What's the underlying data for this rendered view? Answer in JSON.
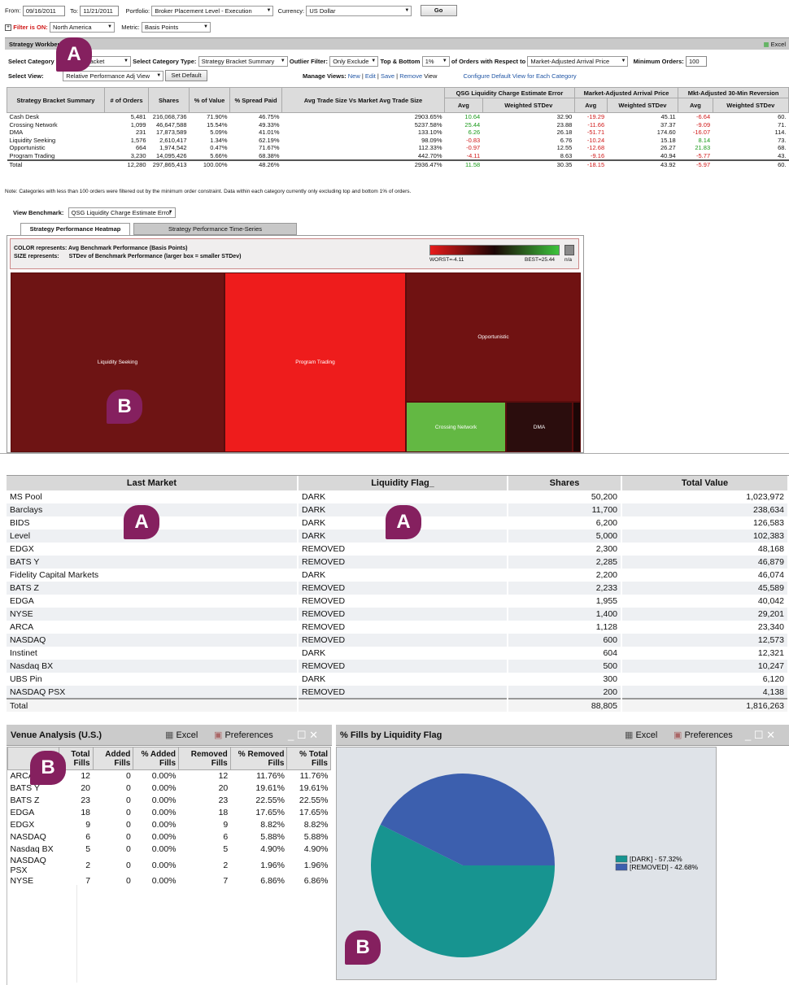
{
  "filters": {
    "from_label": "From:",
    "from_value": "09/16/2011",
    "to_label": "To:",
    "to_value": "11/21/2011",
    "portfolio_label": "Portfolio:",
    "portfolio_value": "Broker Placement Level - Execution",
    "currency_label": "Currency:",
    "currency_value": "US Dollar",
    "go_label": "Go",
    "filter_toggle": "+",
    "filter_label": "Filter is ON:",
    "filter_value": "North America",
    "metric_label": "Metric:",
    "metric_value": "Basis Points"
  },
  "workbench": {
    "title": "Strategy Workbench",
    "excel_label": "Excel",
    "select_category_label": "Select Category",
    "select_category_value": "Strategy Bracket",
    "select_type_label": "Select Category Type:",
    "select_type_value": "Strategy Bracket Summary",
    "outlier_label": "Outlier Filter:",
    "outlier_value": "Only Exclude",
    "topbottom_label": "Top & Bottom",
    "topbottom_value": "1%",
    "respect_label": "of Orders with Respect to",
    "respect_value": "Market-Adjusted Arrival Price",
    "min_orders_label": "Minimum Orders:",
    "min_orders_value": "100",
    "select_view_label": "Select View:",
    "select_view_value": "Relative Performance Adj View",
    "set_default_label": "Set Default",
    "manage_views_label": "Manage Views:",
    "view_new": "New",
    "view_edit": "Edit",
    "view_save": "Save",
    "view_remove": "Remove",
    "view_word": "View",
    "configure_label": "Configure Default View for Each Category",
    "sep": "|"
  },
  "summary": {
    "headers": {
      "category": "Strategy Bracket Summary",
      "orders": "# of Orders",
      "shares": "Shares",
      "pct_value": "% of Value",
      "spread": "% Spread Paid",
      "avg_trade": "Avg Trade Size Vs Market Avg Trade Size",
      "grp1": "QSG Liquidity Charge Estimate Error",
      "grp2": "Market-Adjusted Arrival Price",
      "grp3": "Mkt-Adjusted 30-Min Reversion",
      "avg": "Avg",
      "wstd": "Weighted STDev"
    },
    "rows": [
      {
        "name": "Cash Desk",
        "orders": "5,481",
        "shares": "216,068,736",
        "pct": "71.90%",
        "spread": "46.75%",
        "avgtrade": "2903.65%",
        "a1": "10.64",
        "a1c": "g",
        "w1": "32.90",
        "a2": "-19.29",
        "a2c": "rd",
        "w2": "45.11",
        "a3": "-6.64",
        "a3c": "rd",
        "w3": "60."
      },
      {
        "name": "Crossing Network",
        "orders": "1,099",
        "shares": "46,647,588",
        "pct": "15.54%",
        "spread": "49.33%",
        "avgtrade": "5237.58%",
        "a1": "25.44",
        "a1c": "g",
        "w1": "23.88",
        "a2": "-11.66",
        "a2c": "rd",
        "w2": "37.37",
        "a3": "-9.09",
        "a3c": "rd",
        "w3": "71."
      },
      {
        "name": "DMA",
        "orders": "231",
        "shares": "17,873,589",
        "pct": "5.09%",
        "spread": "41.01%",
        "avgtrade": "133.10%",
        "a1": "6.26",
        "a1c": "g",
        "w1": "26.18",
        "a2": "-51.71",
        "a2c": "rd",
        "w2": "174.60",
        "a3": "-16.07",
        "a3c": "rd",
        "w3": "114."
      },
      {
        "name": "Liquidity Seeking",
        "orders": "1,576",
        "shares": "2,610,417",
        "pct": "1.34%",
        "spread": "62.19%",
        "avgtrade": "98.09%",
        "a1": "-0.83",
        "a1c": "rd",
        "w1": "6.76",
        "a2": "-10.24",
        "a2c": "rd",
        "w2": "15.18",
        "a3": "8.14",
        "a3c": "g",
        "w3": "73."
      },
      {
        "name": "Opportunistic",
        "orders": "664",
        "shares": "1,974,542",
        "pct": "0.47%",
        "spread": "71.67%",
        "avgtrade": "112.33%",
        "a1": "-0.97",
        "a1c": "rd",
        "w1": "12.55",
        "a2": "-12.68",
        "a2c": "rd",
        "w2": "26.27",
        "a3": "21.83",
        "a3c": "g",
        "w3": "68."
      },
      {
        "name": "Program Trading",
        "orders": "3,230",
        "shares": "14,095,426",
        "pct": "5.66%",
        "spread": "68.38%",
        "avgtrade": "442.70%",
        "a1": "-4.11",
        "a1c": "rd",
        "w1": "8.63",
        "a2": "-9.16",
        "a2c": "rd",
        "w2": "40.94",
        "a3": "-5.77",
        "a3c": "rd",
        "w3": "43."
      }
    ],
    "total": {
      "name": "Total",
      "orders": "12,280",
      "shares": "297,865,413",
      "pct": "100.00%",
      "spread": "48.26%",
      "avgtrade": "2936.47%",
      "a1": "11.58",
      "a1c": "g",
      "w1": "30.35",
      "a2": "-18.15",
      "a2c": "rd",
      "w2": "43.92",
      "a3": "-5.97",
      "a3c": "rd",
      "w3": "60."
    },
    "note": "Note: Categories with less than 100 orders were filtered out by the minimum order constraint. Data within each category currently only excluding top and bottom 1% of orders."
  },
  "benchmark": {
    "label": "View Benchmark:",
    "value": "QSG Liquidity Charge Estimate Error",
    "tab_active": "Strategy Performance Heatmap",
    "tab_inactive": "Strategy Performance Time-Series"
  },
  "heatmap": {
    "color_line": "COLOR represents: Avg Benchmark Performance (Basis Points)",
    "size_label": "SIZE represents:",
    "size_text": "STDev of Benchmark Performance (larger box = smaller STDev)",
    "worst": "WORST=-4.11",
    "best": "BEST=25.44",
    "na": "n/a",
    "tiles": {
      "liquidity": "Liquidity Seeking",
      "program": "Program Trading",
      "opportunistic": "Opportunistic",
      "crossing": "Crossing Network",
      "dma": "DMA"
    },
    "colors": {
      "liquidity": "#6e1414",
      "program": "#ee1c1c",
      "opportunistic": "#701212",
      "crossing": "#63b843",
      "dma": "#2b0d0d"
    }
  },
  "market": {
    "headers": {
      "market": "Last Market",
      "flag": "Liquidity Flag_",
      "shares": "Shares",
      "value": "Total Value"
    },
    "rows": [
      {
        "m": "MS Pool",
        "f": "DARK",
        "s": "50,200",
        "v": "1,023,972"
      },
      {
        "m": "Barclays",
        "f": "DARK",
        "s": "11,700",
        "v": "238,634"
      },
      {
        "m": "BIDS",
        "f": "DARK",
        "s": "6,200",
        "v": "126,583"
      },
      {
        "m": "Level",
        "f": "DARK",
        "s": "5,000",
        "v": "102,383"
      },
      {
        "m": "EDGX",
        "f": "REMOVED",
        "s": "2,300",
        "v": "48,168"
      },
      {
        "m": "BATS Y",
        "f": "REMOVED",
        "s": "2,285",
        "v": "46,879"
      },
      {
        "m": "Fidelity Capital Markets",
        "f": "DARK",
        "s": "2,200",
        "v": "46,074"
      },
      {
        "m": "BATS Z",
        "f": "REMOVED",
        "s": "2,233",
        "v": "45,589"
      },
      {
        "m": "EDGA",
        "f": "REMOVED",
        "s": "1,955",
        "v": "40,042"
      },
      {
        "m": "NYSE",
        "f": "REMOVED",
        "s": "1,400",
        "v": "29,201"
      },
      {
        "m": "ARCA",
        "f": "REMOVED",
        "s": "1,128",
        "v": "23,340"
      },
      {
        "m": "NASDAQ",
        "f": "REMOVED",
        "s": "600",
        "v": "12,573"
      },
      {
        "m": "Instinet",
        "f": "DARK",
        "s": "604",
        "v": "12,321"
      },
      {
        "m": "Nasdaq BX",
        "f": "REMOVED",
        "s": "500",
        "v": "10,247"
      },
      {
        "m": "UBS Pin",
        "f": "DARK",
        "s": "300",
        "v": "6,120"
      },
      {
        "m": "NASDAQ PSX",
        "f": "REMOVED",
        "s": "200",
        "v": "4,138"
      }
    ],
    "total": {
      "m": "Total",
      "s": "88,805",
      "v": "1,816,263"
    }
  },
  "venue": {
    "title": "Venue Analysis (U.S.)",
    "excel_label": "Excel",
    "prefs_label": "Preferences",
    "headers": [
      "",
      "Total Fills",
      "Added Fills",
      "% Added Fills",
      "Removed Fills",
      "% Removed Fills",
      "% Total Fills"
    ],
    "rows": [
      [
        "ARCA",
        "12",
        "0",
        "0.00%",
        "12",
        "11.76%",
        "11.76%"
      ],
      [
        "BATS Y",
        "20",
        "0",
        "0.00%",
        "20",
        "19.61%",
        "19.61%"
      ],
      [
        "BATS Z",
        "23",
        "0",
        "0.00%",
        "23",
        "22.55%",
        "22.55%"
      ],
      [
        "EDGA",
        "18",
        "0",
        "0.00%",
        "18",
        "17.65%",
        "17.65%"
      ],
      [
        "EDGX",
        "9",
        "0",
        "0.00%",
        "9",
        "8.82%",
        "8.82%"
      ],
      [
        "NASDAQ",
        "6",
        "0",
        "0.00%",
        "6",
        "5.88%",
        "5.88%"
      ],
      [
        "Nasdaq BX",
        "5",
        "0",
        "0.00%",
        "5",
        "4.90%",
        "4.90%"
      ],
      [
        "NASDAQ PSX",
        "2",
        "0",
        "0.00%",
        "2",
        "1.96%",
        "1.96%"
      ],
      [
        "NYSE",
        "7",
        "0",
        "0.00%",
        "7",
        "6.86%",
        "6.86%"
      ]
    ]
  },
  "fills": {
    "title": "% Fills by Liquidity Flag",
    "excel_label": "Excel",
    "prefs_label": "Preferences"
  },
  "chart_data": {
    "type": "pie",
    "title": "% Fills by Liquidity Flag",
    "categories": [
      "[DARK] - 57.32%",
      "[REMOVED] - 42.68%"
    ],
    "values": [
      57.32,
      42.68
    ],
    "colors": [
      "#179490",
      "#3c5fae"
    ],
    "legend": "right"
  },
  "markers": {
    "a": "A",
    "b": "B"
  },
  "window": {
    "minimize": "_",
    "maximize": "☐",
    "close": "✕"
  }
}
